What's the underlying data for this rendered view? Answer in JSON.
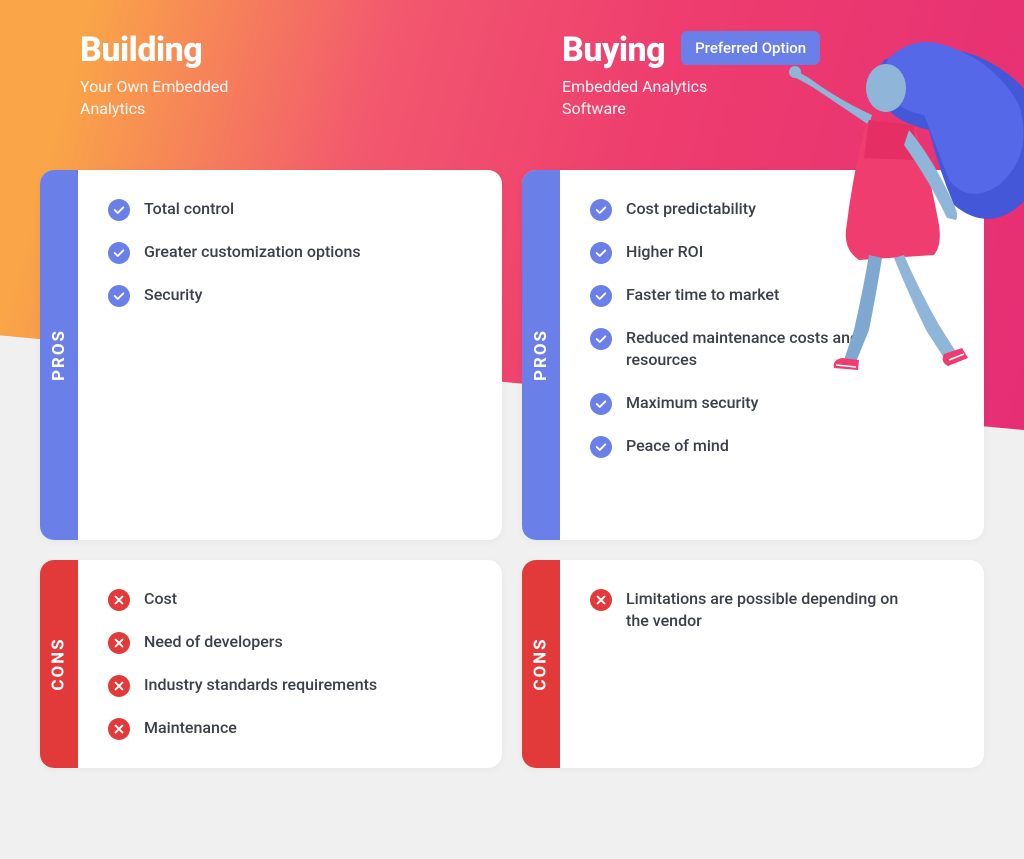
{
  "building": {
    "title": "Building",
    "subtitle": "Your Own Embedded Analytics",
    "pros_label": "PROS",
    "cons_label": "CONS",
    "pros": [
      "Total control",
      "Greater customization options",
      "Security"
    ],
    "cons": [
      "Cost",
      "Need of developers",
      "Industry standards requirements",
      "Maintenance"
    ]
  },
  "buying": {
    "title": "Buying",
    "badge": "Preferred Option",
    "subtitle": "Embedded Analytics Software",
    "pros_label": "PROS",
    "cons_label": "CONS",
    "pros": [
      "Cost predictability",
      "Higher ROI",
      "Faster time to market",
      "Reduced maintenance costs and resources",
      "Maximum security",
      "Peace of mind"
    ],
    "cons": [
      "Limitations are possible depending on the vendor"
    ]
  },
  "colors": {
    "pros": "#6b7fe8",
    "cons": "#e23a3a"
  }
}
